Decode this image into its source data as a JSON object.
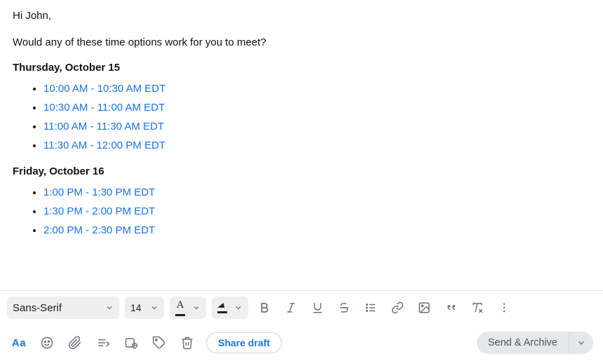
{
  "compose": {
    "greeting": "Hi John,",
    "question": "Would any of these time options work for you to meet?",
    "groups": [
      {
        "heading": "Thursday, October 15",
        "slots": [
          "10:00 AM - 10:30 AM EDT",
          "10:30 AM - 11:00 AM EDT",
          "11:00 AM - 11:30 AM EDT",
          "11:30 AM - 12:00 PM EDT"
        ]
      },
      {
        "heading": "Friday, October 16",
        "slots": [
          "1:00 PM - 1:30 PM EDT",
          "1:30 PM - 2:00 PM EDT",
          "2:00 PM - 2:30 PM EDT"
        ]
      }
    ]
  },
  "toolbar": {
    "font_family": "Sans-Serif",
    "font_size": "14"
  },
  "actions": {
    "share_draft": "Share draft",
    "send_archive": "Send & Archive"
  }
}
